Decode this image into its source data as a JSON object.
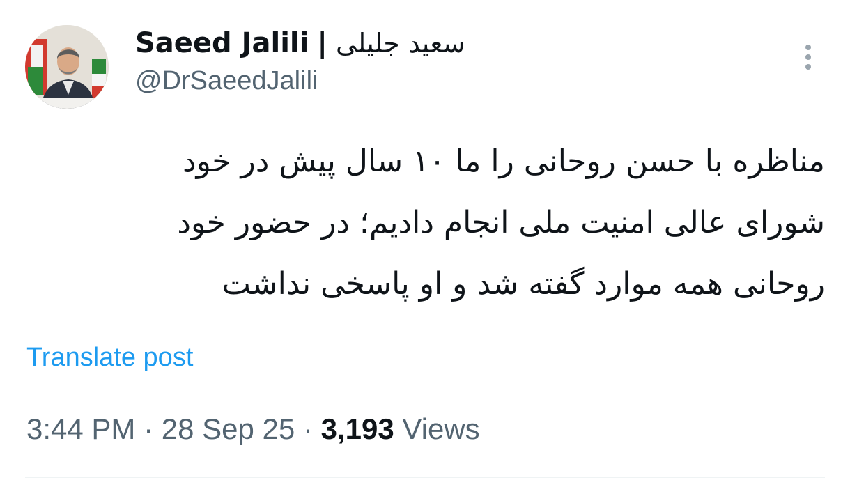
{
  "author": {
    "name_en": "Saeed Jalili",
    "separator": "|",
    "name_fa": "سعید جلیلی",
    "handle": "@DrSaeedJalili",
    "avatar": "profile-photo"
  },
  "tweet": {
    "lines": [
      "مناظره با حسن روحانی را ما ۱۰ سال پیش در خود",
      "شورای عالی امنیت ملی انجام دادیم؛ در حضور خود",
      "روحانی همه موارد گفته شد و او پاسخی نداشت"
    ]
  },
  "translate_label": "Translate post",
  "meta": {
    "time": "3:44 PM",
    "dot": "·",
    "date": "28 Sep 25",
    "views_count": "3,193",
    "views_label": "Views"
  },
  "icons": {
    "more": "more-vertical-icon"
  },
  "colors": {
    "link": "#1d9bf0",
    "secondary_text": "#536471",
    "primary_text": "#0f1419"
  }
}
